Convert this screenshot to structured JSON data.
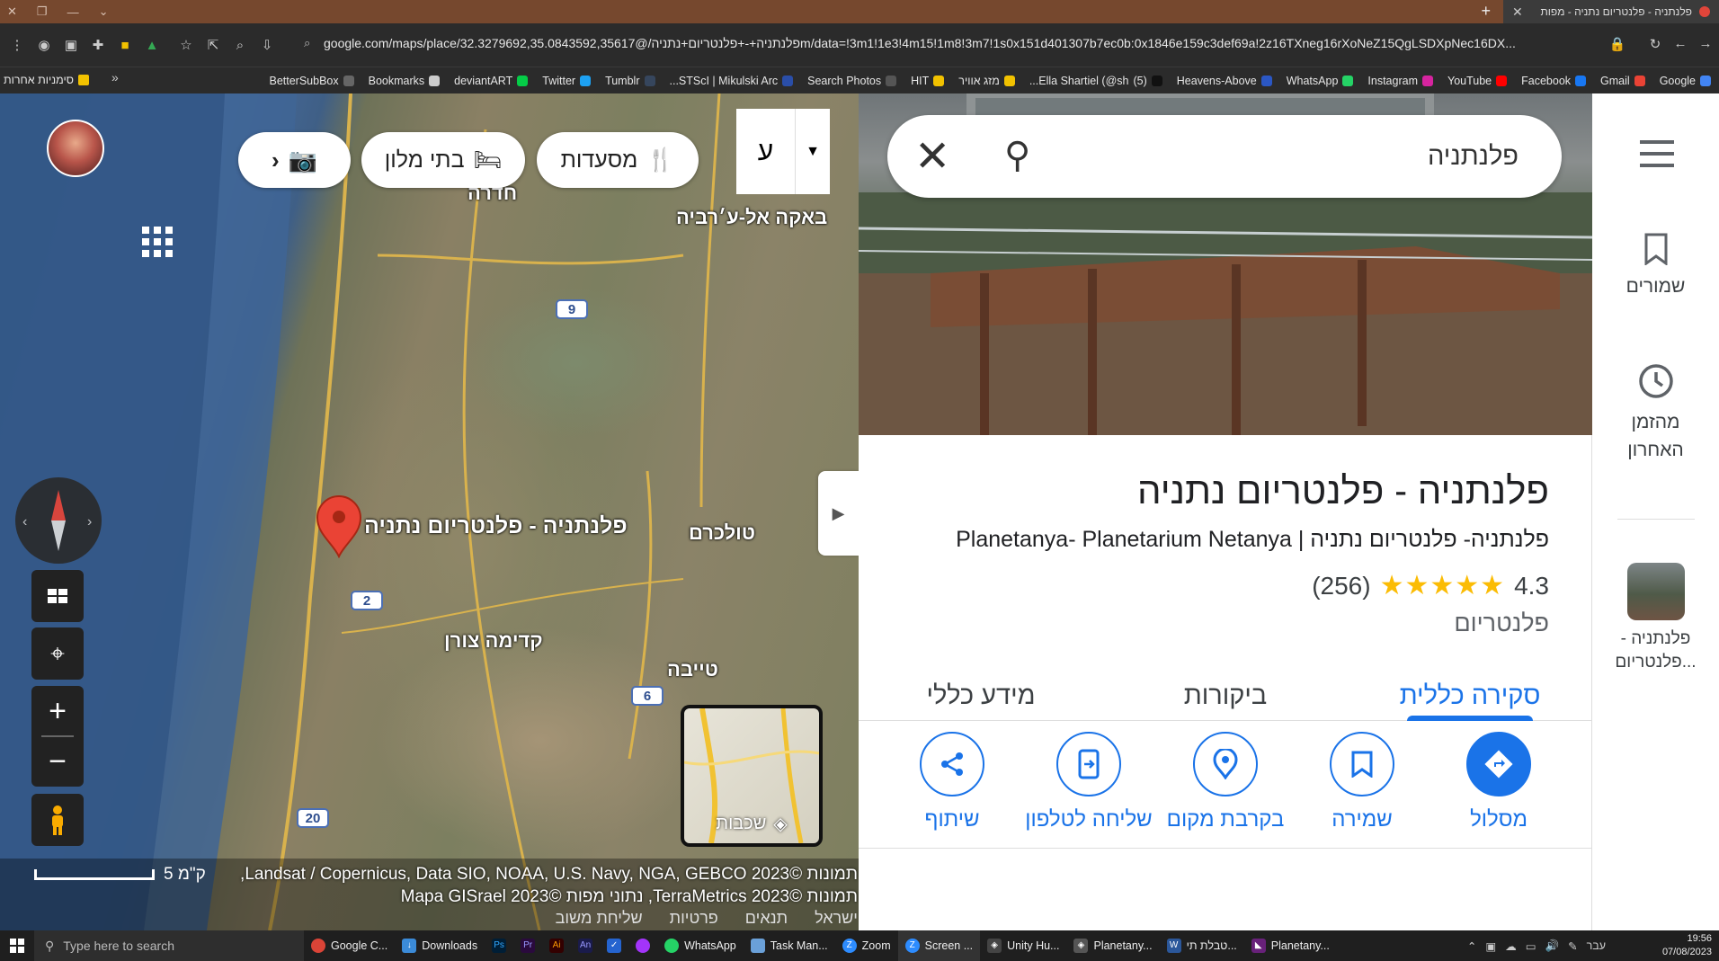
{
  "browser": {
    "tab_title": "פלנתניה - פלנטריום נתניה - מפות",
    "url": "google.com/maps/place/פלנתניה+-+פלנטריום+נתניה/@32.3279692,35.0843592,35617m/data=!3m1!1e3!4m15!1m8!3m7!1s0x151d401307b7ec0b:0x1846e159c3def69a!2z16TXneg16rXoNeZ15QgLSDXpNec16DX...",
    "bookmarks": [
      "Google",
      "Gmail",
      "Facebook",
      "YouTube",
      "Instagram",
      "WhatsApp",
      "Heavens-Above",
      "Ella Shartiel (@sh...",
      "מזג אוויר",
      "HIT",
      "Search Photos",
      "STScI | Mikulski Arc...",
      "Tumblr",
      "Twitter",
      "deviantART",
      "Bookmarks",
      "BetterSubBox"
    ],
    "bookmarks_count_prefix": "(5)",
    "other_bookmarks": "סימניות אחרות"
  },
  "map": {
    "chips": {
      "restaurants": "מסעדות",
      "hotels": "בתי מלון",
      "more": "ע"
    },
    "labels": {
      "pin": "פלנתניה - פלנטריום נתניה",
      "hadera": "חדרה",
      "baqa": "באקה אל-ע׳רביה",
      "tulkarm": "טולכרם",
      "kadima": "קדימה צורן",
      "tayibe": "טייבה"
    },
    "roads": [
      "9",
      "2",
      "6",
      "20"
    ],
    "layers_label": "שכבות",
    "scale": "5 ק\"מ",
    "attribution_line1": "תמונות ©2023 Landsat / Copernicus, Data SIO, NOAA, U.S. Navy, NGA, GEBCO,",
    "attribution_line2": "תמונות ©2023 TerraMetrics, נתוני מפות ©2023 Mapa GISrael",
    "links": [
      "ישראל",
      "תנאים",
      "פרטיות",
      "שליחת משוב"
    ]
  },
  "panel": {
    "search_value": "פלנתניה",
    "title": "פלנתניה - פלנטריום נתניה",
    "subtitle": "פלנתניה- פלנטריום נתניה | Planetanya- Planetarium Netanya",
    "rating": "4.3",
    "review_count": "(256)",
    "stars": "★★★★★",
    "category": "פלנטריום",
    "tabs": [
      "סקירה כללית",
      "ביקורות",
      "מידע כללי"
    ],
    "actions": [
      "מסלול",
      "שמירה",
      "בקרבת מקום",
      "שליחה לטלפון",
      "שיתוף"
    ]
  },
  "rail": {
    "saved": "שמורים",
    "recent": "מהזמן האחרון",
    "recent_place": "פלנתניה - פלנטריום..."
  },
  "taskbar": {
    "search_placeholder": "Type here to search",
    "items": [
      "Google C...",
      "Downloads",
      "WhatsApp",
      "Task Man...",
      "Zoom",
      "Screen ...",
      "Unity Hu...",
      "Planetany...",
      "טבלת תי...",
      "Planetany..."
    ],
    "lang": "עבר",
    "time": "19:56",
    "date": "07/08/2023"
  },
  "colors": {
    "accent": "#1a73e8",
    "star": "#fbbc04",
    "pin": "#ea4335"
  }
}
